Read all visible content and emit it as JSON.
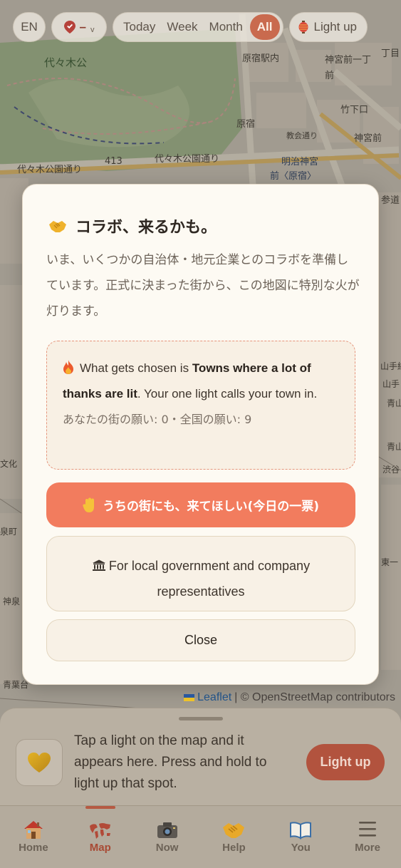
{
  "map": {
    "labels": [
      "代々木公",
      "原宿駅内",
      "神宮前一丁",
      "前",
      "丁目",
      "竹下口",
      "原宿",
      "教会通り",
      "神宮前",
      "明治神宮",
      "前〈原宿〉",
      "413",
      "代々木公園通り",
      "代々木公園通り",
      "参道",
      "山手線",
      "山手",
      "青山",
      "青山",
      "渋谷",
      "東一",
      "神泉",
      "泉町",
      "青葉台",
      "文化"
    ]
  },
  "topbar": {
    "lang": "EN",
    "location_value": "–",
    "ranges": [
      "Today",
      "Week",
      "Month",
      "All"
    ],
    "active_range": "All",
    "light_label": "Light up"
  },
  "modal": {
    "icon": "handshake-icon",
    "title": "コラボ、来るかも。",
    "body": "いま、いくつかの自治体・地元企業とのコラボを準備しています。正式に決まった街から、この地図に特別な火が灯ります。",
    "info": {
      "icon": "flame-icon",
      "prefix": "What gets chosen is ",
      "bold": "Towns where a lot of thanks are lit",
      "suffix": ". Your one light calls your town in.",
      "counts": "あなたの街の願い: 0・全国の願い: 9"
    },
    "vote_label": "うちの街にも、来てほしい(今日の一票)",
    "rep_label": "For local government and company representatives",
    "close_label": "Close"
  },
  "attribution": {
    "leaflet": "Leaflet",
    "rest": "| © OpenStreetMap contributors"
  },
  "sheet": {
    "text": "Tap a light on the map and it appears here. Press and hold to light up that spot.",
    "button": "Light up"
  },
  "tabs": [
    {
      "label": "Home",
      "icon": "house-icon"
    },
    {
      "label": "Map",
      "icon": "world-map-icon"
    },
    {
      "label": "Now",
      "icon": "camera-icon"
    },
    {
      "label": "Help",
      "icon": "handshake-icon"
    },
    {
      "label": "You",
      "icon": "book-icon"
    },
    {
      "label": "More",
      "icon": "menu-icon"
    }
  ],
  "active_tab": "Map",
  "colors": {
    "accent": "#f27c5e",
    "active_range": "#c96a4e",
    "modal_bg": "#fdfaf3",
    "dashed_border": "#e6957c",
    "active_tab": "#a84a34"
  }
}
